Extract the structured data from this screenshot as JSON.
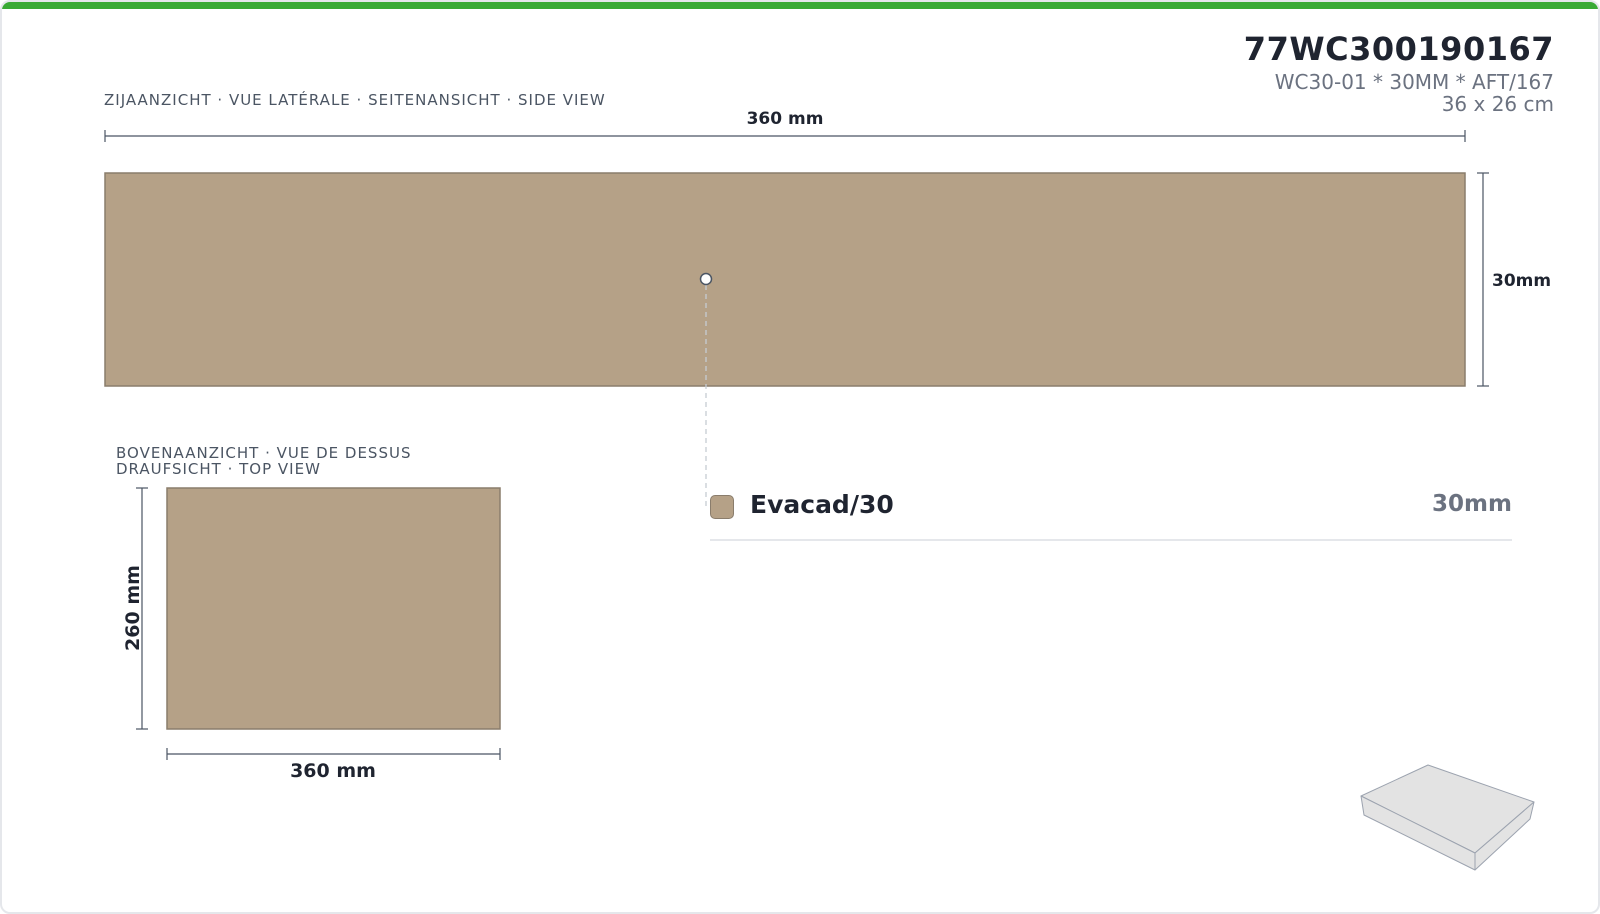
{
  "header": {
    "code": "77WC300190167",
    "description": "WC30-01 * 30MM * AFT/167",
    "size": "36 x 26 cm"
  },
  "colors": {
    "accent_bar": "#3aaa35",
    "material": "#b5a187",
    "material_stroke": "#8a7d6c",
    "box_face": "#e3e3e3"
  },
  "side_view": {
    "title": "ZIJAANZICHT · VUE LATÉRALE · SEITENANSICHT · SIDE VIEW",
    "width_label": "360 mm",
    "height_label": "30mm"
  },
  "top_view": {
    "title_line1": "BOVENAANZICHT · VUE DE DESSUS",
    "title_line2": "DRAUFSICHT · TOP VIEW",
    "depth_label": "260 mm",
    "width_label": "360 mm"
  },
  "legend": {
    "items": [
      {
        "name": "Evacad/30",
        "thickness": "30mm"
      }
    ]
  },
  "icons": {
    "preview": "isometric-box-icon",
    "marker": "layer-marker-icon"
  }
}
